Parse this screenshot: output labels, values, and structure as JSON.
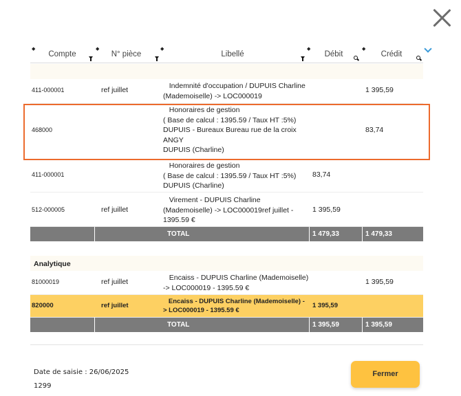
{
  "columns": {
    "compte": "Compte",
    "piece": "N° pièce",
    "libelle": "Libellé",
    "debit": "Débit",
    "credit": "Crédit"
  },
  "general_rows": [
    {
      "account": "411-000001",
      "piece": "ref juillet",
      "libelle": [
        "   Indemnité d'occupation / DUPUIS Charline",
        "(Mademoiselle) -> LOC000019"
      ],
      "debit": "",
      "credit": "1 395,59"
    },
    {
      "account": "468000",
      "piece": "",
      "libelle": [
        "   Honoraires de gestion",
        "( Base de calcul : 1395.59 / Taux HT :5%)",
        "DUPUIS - Bureaux Bureau rue de la croix",
        "ANGY",
        "DUPUIS (Charline)"
      ],
      "debit": "",
      "credit": "83,74"
    },
    {
      "account": "411-000001",
      "piece": "",
      "libelle": [
        "   Honoraires de gestion",
        "( Base de calcul : 1395.59 / Taux HT :5%)",
        "DUPUIS (Charline)"
      ],
      "debit": "83,74",
      "credit": ""
    },
    {
      "account": "512-000005",
      "piece": "ref juillet",
      "libelle": [
        "   Virement - DUPUIS Charline",
        "(Mademoiselle) -> LOC000019ref juillet -",
        "1395.59 €"
      ],
      "debit": "1 395,59",
      "credit": ""
    }
  ],
  "general_total": {
    "label": "TOTAL",
    "debit": "1 479,33",
    "credit": "1 479,33"
  },
  "analytic_title": "Analytique",
  "analytic_rows": [
    {
      "account": "81000019",
      "piece": "ref juillet",
      "libelle": [
        "   Encaiss - DUPUIS Charline (Mademoiselle)",
        "-> LOC000019 - 1395.59 €"
      ],
      "debit": "",
      "credit": "1 395,59"
    },
    {
      "account": "820000",
      "piece": "ref juillet",
      "libelle": [
        "   Encaiss - DUPUIS Charline (Mademoiselle) -",
        "> LOC000019 - 1395.59 €"
      ],
      "debit": "1 395,59",
      "credit": ""
    }
  ],
  "analytic_total": {
    "label": "TOTAL",
    "debit": "1 395,59",
    "credit": "1 395,59"
  },
  "footer": {
    "date_label": "Date de saisie : 26/06/2025",
    "number": "1299"
  },
  "buttons": {
    "close": "Fermer"
  },
  "colors": {
    "highlight": "#ec6a2c",
    "selected_row": "#fdd062",
    "button": "#fec240",
    "total_bg": "#7b7b7b",
    "chevron": "#3a9ad9"
  }
}
